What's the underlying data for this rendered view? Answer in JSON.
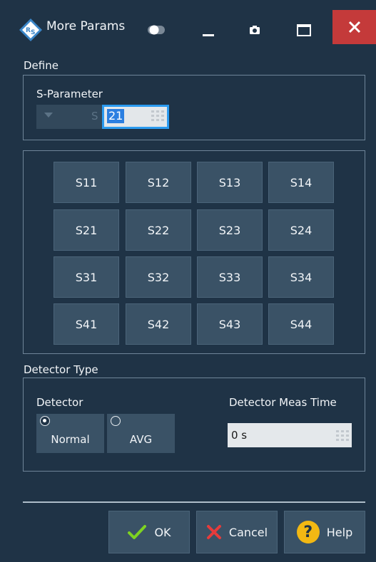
{
  "window": {
    "title": "More Params",
    "icons": [
      "rs-logo-icon",
      "toggle-icon",
      "minimize-icon",
      "camera-icon",
      "maximize-icon",
      "close-icon"
    ],
    "close_color": "#c43a3a"
  },
  "define": {
    "label": "Define",
    "sparam": {
      "label": "S-Parameter",
      "prefix": "S",
      "value": "21"
    },
    "buttons": [
      [
        "S11",
        "S12",
        "S13",
        "S14"
      ],
      [
        "S21",
        "S22",
        "S23",
        "S24"
      ],
      [
        "S31",
        "S32",
        "S33",
        "S34"
      ],
      [
        "S41",
        "S42",
        "S43",
        "S44"
      ]
    ]
  },
  "detector_type": {
    "label": "Detector Type",
    "detector": {
      "label": "Detector",
      "options": [
        {
          "label": "Normal",
          "selected": true
        },
        {
          "label": "AVG",
          "selected": false
        }
      ]
    },
    "meas_time": {
      "label": "Detector Meas Time",
      "value": "0 s"
    }
  },
  "actions": {
    "ok": "OK",
    "cancel": "Cancel",
    "help": "Help"
  },
  "colors": {
    "background": "#1f3346",
    "button": "#3a5266",
    "accent": "#2b9bf0",
    "ok_check": "#7ed321",
    "cancel_x": "#e63b3b",
    "help": "#f2b813"
  }
}
